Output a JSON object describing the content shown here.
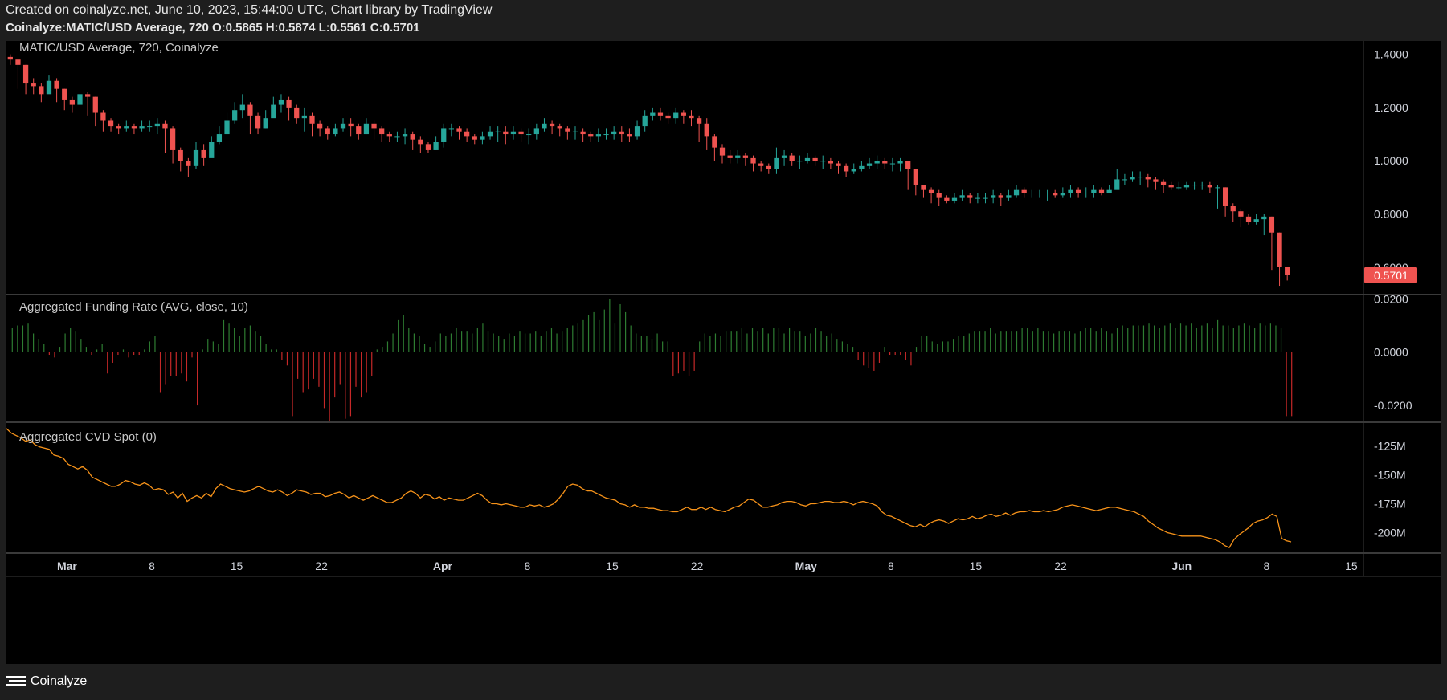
{
  "header": {
    "created_text": "Created on coinalyze.net, June 10, 2023, 15:44:00 UTC, Chart library by TradingView",
    "ohlc_text": "Coinalyze:MATIC/USD Average, 720 O:0.5865 H:0.5874 L:0.5561 C:0.5701"
  },
  "footer": {
    "brand": "Coinalyze",
    "icon": "coinalyze-logo-icon"
  },
  "colors": {
    "background": "#000000",
    "up": "#26a69a",
    "down": "#ef5350",
    "funding_pos": "#2e7d32",
    "funding_neg": "#c62828",
    "cvd": "#f7931a",
    "grid": "#2a2a2a",
    "axis_text": "#d1d4dc"
  },
  "chart_data": [
    {
      "type": "candlestick",
      "title": "MATIC/USD Average, 720, Coinalyze",
      "ylim": [
        0.5,
        1.45
      ],
      "yticks": [
        "1.4000",
        "1.2000",
        "1.0000",
        "0.8000",
        "0.6000"
      ],
      "ytick_values": [
        1.4,
        1.2,
        1.0,
        0.8,
        0.6
      ],
      "last_price_label": "0.5701",
      "xticks": [
        "Mar",
        "8",
        "15",
        "22",
        "Apr",
        "8",
        "15",
        "22",
        "May",
        "8",
        "15",
        "22",
        "Jun",
        "8",
        "15"
      ],
      "xtick_days": [
        5,
        12,
        19,
        26,
        36,
        43,
        50,
        57,
        66,
        73,
        80,
        87,
        97,
        104,
        111
      ],
      "x_start_day": 0,
      "x_end_day": 112,
      "bars_per_day": 2,
      "close": [
        1.38,
        1.36,
        1.29,
        1.28,
        1.25,
        1.3,
        1.27,
        1.23,
        1.21,
        1.25,
        1.24,
        1.18,
        1.15,
        1.13,
        1.12,
        1.13,
        1.12,
        1.13,
        1.13,
        1.14,
        1.12,
        1.04,
        1.0,
        0.98,
        1.04,
        1.01,
        1.07,
        1.1,
        1.15,
        1.19,
        1.21,
        1.17,
        1.12,
        1.16,
        1.21,
        1.23,
        1.2,
        1.16,
        1.17,
        1.14,
        1.12,
        1.1,
        1.12,
        1.14,
        1.13,
        1.1,
        1.14,
        1.12,
        1.1,
        1.09,
        1.09,
        1.1,
        1.08,
        1.06,
        1.04,
        1.07,
        1.12,
        1.12,
        1.11,
        1.09,
        1.08,
        1.09,
        1.11,
        1.11,
        1.1,
        1.11,
        1.1,
        1.1,
        1.12,
        1.14,
        1.13,
        1.12,
        1.11,
        1.11,
        1.1,
        1.09,
        1.1,
        1.1,
        1.11,
        1.1,
        1.09,
        1.13,
        1.17,
        1.18,
        1.17,
        1.16,
        1.18,
        1.17,
        1.16,
        1.14,
        1.09,
        1.05,
        1.02,
        1.01,
        1.02,
        1.01,
        0.99,
        0.98,
        0.97,
        1.01,
        1.02,
        1.0,
        1.0,
        1.01,
        1.0,
        1.0,
        0.99,
        0.98,
        0.96,
        0.97,
        0.98,
        0.99,
        1.0,
        0.99,
        0.99,
        1.0,
        0.97,
        0.91,
        0.89,
        0.88,
        0.86,
        0.85,
        0.86,
        0.87,
        0.86,
        0.86,
        0.86,
        0.87,
        0.86,
        0.87,
        0.89,
        0.88,
        0.88,
        0.88,
        0.88,
        0.87,
        0.88,
        0.89,
        0.88,
        0.88,
        0.89,
        0.88,
        0.89,
        0.93,
        0.93,
        0.94,
        0.94,
        0.93,
        0.92,
        0.91,
        0.9,
        0.9,
        0.91,
        0.91,
        0.91,
        0.9,
        0.9,
        0.83,
        0.81,
        0.79,
        0.77,
        0.78,
        0.79,
        0.73,
        0.6,
        0.57
      ],
      "high": [
        1.4,
        1.38,
        1.36,
        1.31,
        1.29,
        1.32,
        1.31,
        1.27,
        1.24,
        1.27,
        1.26,
        1.24,
        1.19,
        1.16,
        1.14,
        1.15,
        1.14,
        1.15,
        1.15,
        1.16,
        1.15,
        1.13,
        1.05,
        1.01,
        1.07,
        1.06,
        1.09,
        1.13,
        1.18,
        1.22,
        1.25,
        1.22,
        1.18,
        1.19,
        1.24,
        1.25,
        1.24,
        1.21,
        1.2,
        1.18,
        1.15,
        1.13,
        1.14,
        1.16,
        1.16,
        1.14,
        1.16,
        1.15,
        1.13,
        1.11,
        1.11,
        1.12,
        1.11,
        1.09,
        1.07,
        1.09,
        1.14,
        1.14,
        1.13,
        1.12,
        1.1,
        1.11,
        1.13,
        1.13,
        1.13,
        1.13,
        1.12,
        1.12,
        1.14,
        1.16,
        1.15,
        1.14,
        1.13,
        1.13,
        1.12,
        1.11,
        1.12,
        1.12,
        1.13,
        1.13,
        1.12,
        1.15,
        1.19,
        1.2,
        1.2,
        1.18,
        1.2,
        1.19,
        1.19,
        1.17,
        1.16,
        1.1,
        1.06,
        1.04,
        1.04,
        1.03,
        1.02,
        1.0,
        0.99,
        1.05,
        1.04,
        1.03,
        1.02,
        1.03,
        1.02,
        1.02,
        1.01,
        1.0,
        0.99,
        0.99,
        1.0,
        1.01,
        1.02,
        1.01,
        1.01,
        1.01,
        1.0,
        0.97,
        0.91,
        0.9,
        0.89,
        0.87,
        0.88,
        0.89,
        0.88,
        0.88,
        0.88,
        0.89,
        0.88,
        0.89,
        0.91,
        0.9,
        0.89,
        0.89,
        0.89,
        0.89,
        0.9,
        0.91,
        0.9,
        0.9,
        0.91,
        0.9,
        0.91,
        0.97,
        0.95,
        0.96,
        0.96,
        0.95,
        0.94,
        0.93,
        0.92,
        0.92,
        0.92,
        0.92,
        0.92,
        0.92,
        0.91,
        0.9,
        0.84,
        0.82,
        0.8,
        0.8,
        0.8,
        0.79,
        0.73,
        0.6
      ],
      "low": [
        1.36,
        1.27,
        1.25,
        1.25,
        1.22,
        1.26,
        1.22,
        1.19,
        1.18,
        1.2,
        1.17,
        1.13,
        1.11,
        1.11,
        1.1,
        1.11,
        1.1,
        1.11,
        1.11,
        1.1,
        1.03,
        0.99,
        0.96,
        0.94,
        0.97,
        0.98,
        1.02,
        1.06,
        1.1,
        1.14,
        1.16,
        1.1,
        1.1,
        1.12,
        1.17,
        1.18,
        1.15,
        1.14,
        1.11,
        1.09,
        1.09,
        1.08,
        1.09,
        1.11,
        1.09,
        1.08,
        1.1,
        1.08,
        1.07,
        1.07,
        1.07,
        1.06,
        1.04,
        1.03,
        1.03,
        1.04,
        1.05,
        1.09,
        1.08,
        1.07,
        1.06,
        1.06,
        1.08,
        1.07,
        1.06,
        1.08,
        1.07,
        1.06,
        1.08,
        1.11,
        1.1,
        1.09,
        1.08,
        1.08,
        1.07,
        1.07,
        1.07,
        1.08,
        1.08,
        1.07,
        1.07,
        1.08,
        1.11,
        1.15,
        1.15,
        1.14,
        1.14,
        1.14,
        1.13,
        1.07,
        1.04,
        1.0,
        0.99,
        0.99,
        0.99,
        0.98,
        0.96,
        0.96,
        0.95,
        0.95,
        0.98,
        0.98,
        0.97,
        0.99,
        0.98,
        0.97,
        0.97,
        0.95,
        0.94,
        0.95,
        0.96,
        0.97,
        0.97,
        0.97,
        0.96,
        0.96,
        0.89,
        0.87,
        0.86,
        0.84,
        0.83,
        0.84,
        0.84,
        0.85,
        0.84,
        0.84,
        0.84,
        0.84,
        0.83,
        0.85,
        0.86,
        0.86,
        0.86,
        0.86,
        0.85,
        0.86,
        0.86,
        0.86,
        0.86,
        0.86,
        0.86,
        0.87,
        0.88,
        0.91,
        0.91,
        0.92,
        0.91,
        0.9,
        0.89,
        0.88,
        0.89,
        0.89,
        0.89,
        0.89,
        0.89,
        0.88,
        0.82,
        0.79,
        0.77,
        0.75,
        0.76,
        0.76,
        0.72,
        0.59,
        0.53,
        0.55
      ]
    },
    {
      "type": "bar",
      "title": "Aggregated Funding Rate (AVG, close, 10)",
      "ylim": [
        -0.026,
        0.021
      ],
      "yticks": [
        "0.0200",
        "0.0000",
        "-0.0200"
      ],
      "ytick_values": [
        0.02,
        0.0,
        -0.02
      ],
      "values": [
        0.009,
        0.01,
        0.01,
        0.011,
        0.007,
        0.005,
        0.003,
        -0.001,
        -0.002,
        0.002,
        0.007,
        0.009,
        0.008,
        0.005,
        0.002,
        -0.001,
        0.001,
        0.003,
        -0.008,
        -0.004,
        -0.001,
        0.001,
        -0.002,
        -0.001,
        -0.001,
        0.001,
        0.004,
        0.006,
        -0.015,
        -0.012,
        -0.009,
        -0.009,
        -0.008,
        -0.011,
        -0.002,
        -0.02,
        0.001,
        0.005,
        0.004,
        0.003,
        0.012,
        0.011,
        0.009,
        0.006,
        0.009,
        0.01,
        0.008,
        0.006,
        0.003,
        0.001,
        0.001,
        -0.003,
        -0.005,
        -0.024,
        -0.01,
        -0.015,
        -0.014,
        -0.01,
        -0.013,
        -0.021,
        -0.026,
        -0.017,
        -0.012,
        -0.025,
        -0.024,
        -0.013,
        -0.017,
        -0.015,
        -0.009,
        0.001,
        0.002,
        0.004,
        0.007,
        0.012,
        0.014,
        0.009,
        0.007,
        0.006,
        0.003,
        0.002,
        0.004,
        0.007,
        0.006,
        0.007,
        0.009,
        0.008,
        0.008,
        0.007,
        0.009,
        0.011,
        0.008,
        0.007,
        0.006,
        0.005,
        0.007,
        0.006,
        0.008,
        0.007,
        0.007,
        0.008,
        0.006,
        0.008,
        0.009,
        0.007,
        0.008,
        0.009,
        0.01,
        0.011,
        0.012,
        0.014,
        0.015,
        0.012,
        0.016,
        0.02,
        0.011,
        0.018,
        0.015,
        0.01,
        0.007,
        0.006,
        0.006,
        0.005,
        0.007,
        0.004,
        0.004,
        -0.009,
        -0.008,
        -0.007,
        -0.009,
        -0.007,
        0.004,
        0.007,
        0.006,
        0.007,
        0.006,
        0.008,
        0.008,
        0.008,
        0.009,
        0.007,
        0.009,
        0.008,
        0.009,
        0.007,
        0.009,
        0.009,
        0.007,
        0.009,
        0.008,
        0.008,
        0.006,
        0.007,
        0.009,
        0.008,
        0.006,
        0.007,
        0.005,
        0.004,
        0.003,
        0.002,
        -0.003,
        -0.005,
        -0.006,
        -0.007,
        -0.004,
        0.002,
        -0.001,
        -0.001,
        -0.001,
        -0.003,
        -0.005,
        0.002,
        0.006,
        0.006,
        0.004,
        0.003,
        0.004,
        0.004,
        0.005,
        0.006,
        0.006,
        0.007,
        0.008,
        0.008,
        0.008,
        0.009,
        0.007,
        0.008,
        0.008,
        0.008,
        0.008,
        0.009,
        0.009,
        0.008,
        0.009,
        0.008,
        0.008,
        0.007,
        0.008,
        0.008,
        0.008,
        0.007,
        0.008,
        0.009,
        0.009,
        0.008,
        0.009,
        0.008,
        0.007,
        0.009,
        0.01,
        0.009,
        0.01,
        0.01,
        0.01,
        0.011,
        0.01,
        0.009,
        0.01,
        0.011,
        0.009,
        0.011,
        0.01,
        0.011,
        0.009,
        0.01,
        0.011,
        0.009,
        0.012,
        0.01,
        0.01,
        0.009,
        0.01,
        0.011,
        0.01,
        0.009,
        0.011,
        0.01,
        0.011,
        0.01,
        0.009,
        -0.024,
        -0.024
      ]
    },
    {
      "type": "line",
      "title": "Aggregated CVD Spot (0)",
      "ylim": [
        -217,
        -106
      ],
      "yticks": [
        "-125M",
        "-150M",
        "-175M",
        "-200M"
      ],
      "ytick_values": [
        -125,
        -150,
        -175,
        -200
      ],
      "unit": "M",
      "values": [
        -110,
        -114,
        -116,
        -118,
        -121,
        -120,
        -124,
        -126,
        -127,
        -128,
        -133,
        -134,
        -136,
        -141,
        -143,
        -145,
        -143,
        -146,
        -152,
        -154,
        -156,
        -158,
        -160,
        -160,
        -158,
        -155,
        -156,
        -158,
        -159,
        -157,
        -159,
        -163,
        -162,
        -163,
        -167,
        -165,
        -170,
        -166,
        -173,
        -170,
        -168,
        -170,
        -166,
        -169,
        -162,
        -158,
        -160,
        -162,
        -163,
        -164,
        -165,
        -164,
        -162,
        -160,
        -162,
        -164,
        -165,
        -163,
        -165,
        -168,
        -166,
        -163,
        -164,
        -165,
        -167,
        -166,
        -166,
        -169,
        -168,
        -166,
        -165,
        -167,
        -170,
        -168,
        -170,
        -172,
        -170,
        -168,
        -170,
        -172,
        -174,
        -174,
        -172,
        -170,
        -166,
        -164,
        -166,
        -170,
        -167,
        -168,
        -171,
        -169,
        -172,
        -170,
        -171,
        -172,
        -172,
        -170,
        -168,
        -166,
        -168,
        -172,
        -175,
        -175,
        -176,
        -175,
        -176,
        -177,
        -178,
        -178,
        -176,
        -177,
        -176,
        -178,
        -177,
        -175,
        -171,
        -166,
        -160,
        -158,
        -159,
        -162,
        -164,
        -164,
        -166,
        -168,
        -170,
        -171,
        -172,
        -175,
        -176,
        -178,
        -176,
        -178,
        -178,
        -179,
        -179,
        -180,
        -181,
        -181,
        -182,
        -182,
        -180,
        -178,
        -180,
        -180,
        -178,
        -180,
        -178,
        -180,
        -181,
        -182,
        -180,
        -178,
        -177,
        -174,
        -171,
        -172,
        -175,
        -178,
        -178,
        -177,
        -176,
        -174,
        -173,
        -173,
        -174,
        -176,
        -177,
        -175,
        -175,
        -174,
        -173,
        -173,
        -174,
        -174,
        -173,
        -174,
        -176,
        -174,
        -173,
        -174,
        -175,
        -177,
        -182,
        -185,
        -186,
        -188,
        -190,
        -192,
        -194,
        -195,
        -193,
        -195,
        -192,
        -190,
        -189,
        -190,
        -192,
        -190,
        -188,
        -189,
        -188,
        -186,
        -188,
        -187,
        -185,
        -184,
        -186,
        -185,
        -183,
        -185,
        -183,
        -182,
        -182,
        -181,
        -182,
        -182,
        -181,
        -182,
        -181,
        -180,
        -178,
        -177,
        -176,
        -177,
        -178,
        -179,
        -180,
        -181,
        -180,
        -179,
        -178,
        -178,
        -179,
        -180,
        -181,
        -182,
        -184,
        -186,
        -190,
        -193,
        -196,
        -198,
        -200,
        -201,
        -202,
        -203,
        -203,
        -203,
        -203,
        -203,
        -204,
        -205,
        -206,
        -208,
        -211,
        -213,
        -206,
        -202,
        -199,
        -196,
        -192,
        -190,
        -189,
        -187,
        -184,
        -186,
        -205,
        -207,
        -208
      ]
    }
  ]
}
